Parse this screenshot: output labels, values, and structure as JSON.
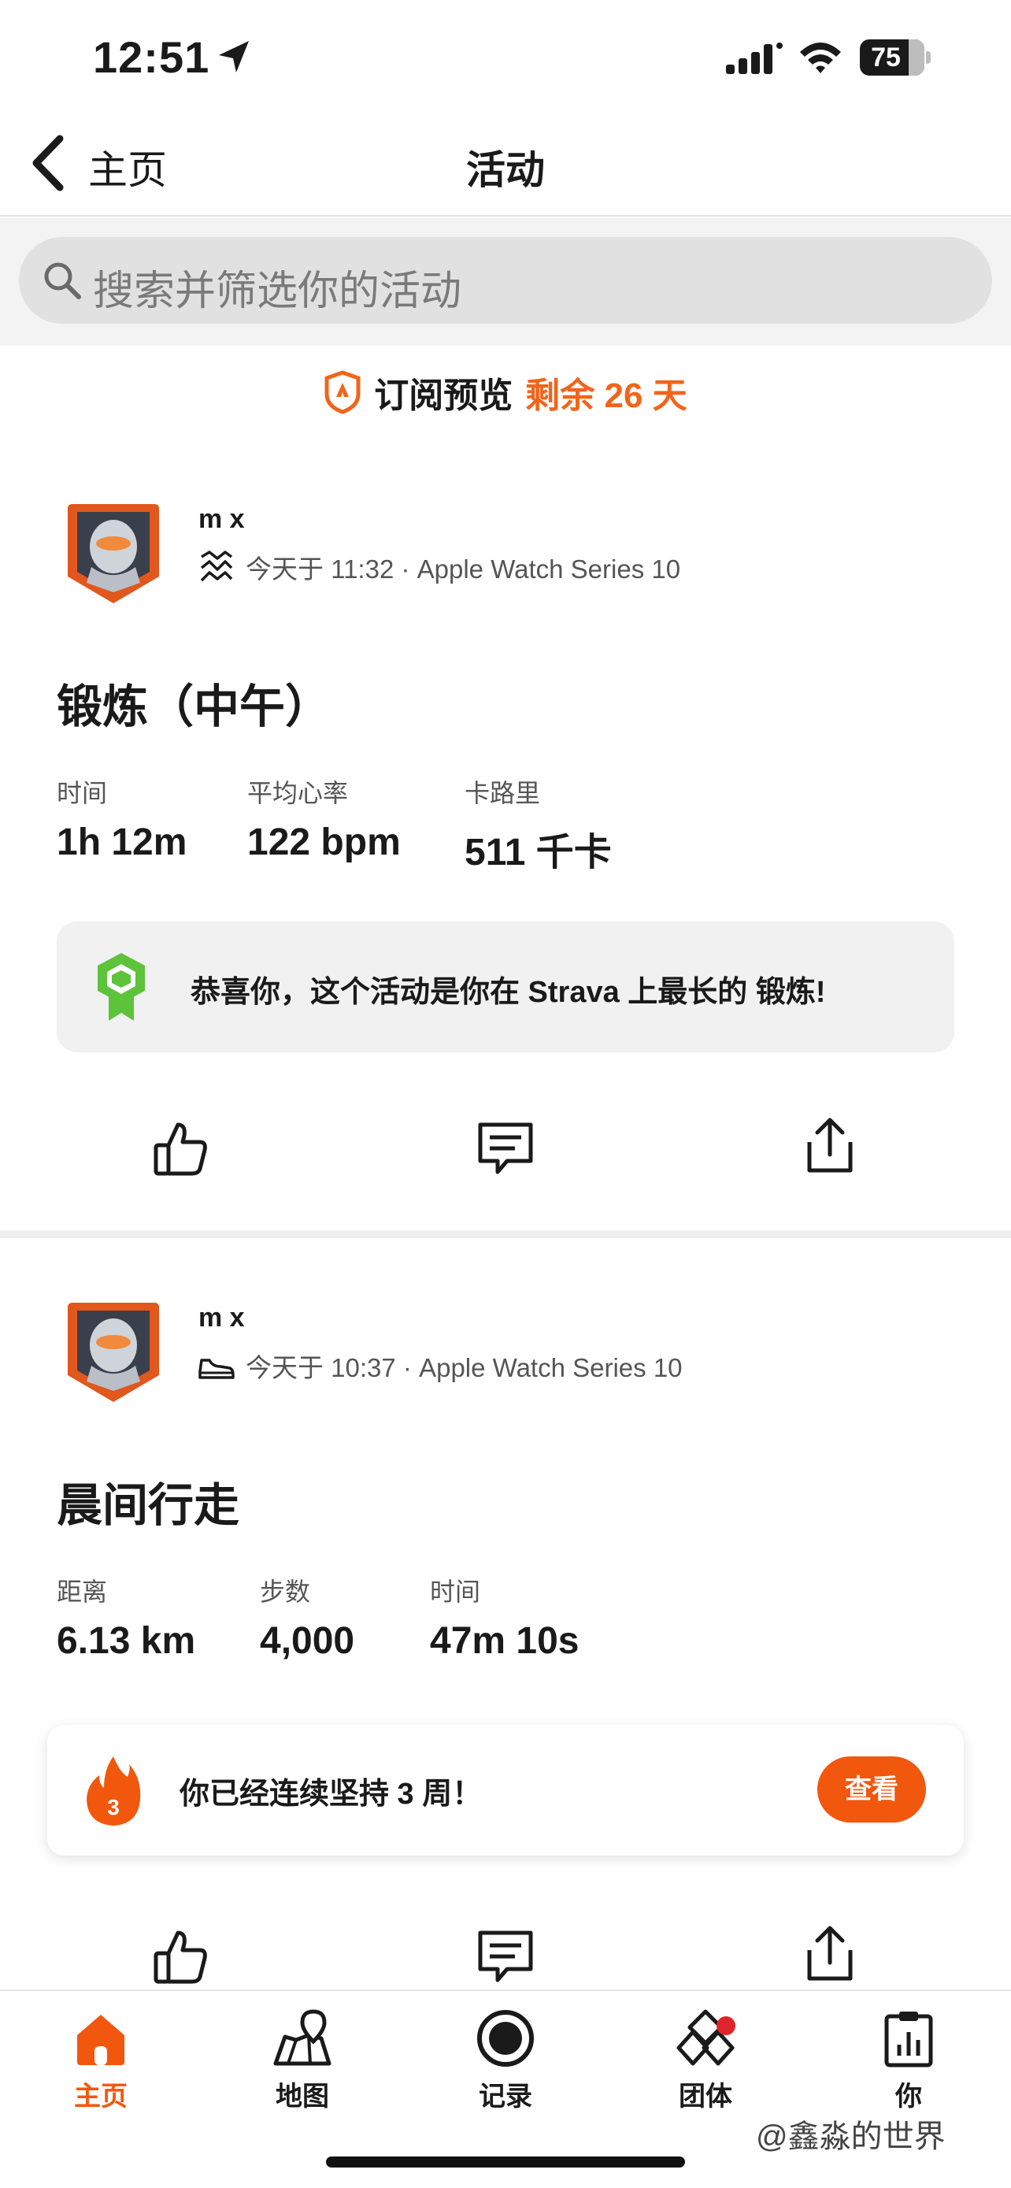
{
  "status_bar": {
    "time": "12:51",
    "battery": "75"
  },
  "nav": {
    "back_label": "主页",
    "title": "活动"
  },
  "search": {
    "placeholder": "搜索并筛选你的活动"
  },
  "subscription": {
    "label": "订阅预览",
    "remaining": "剩余 26 天"
  },
  "activities": [
    {
      "user": "m x",
      "meta": "今天于 11:32 · Apple Watch Series 10",
      "type_icon": "workout-wave-icon",
      "title": "锻炼（中午）",
      "stats": [
        {
          "label": "时间",
          "value": "1h 12m"
        },
        {
          "label": "平均心率",
          "value": "122 bpm"
        },
        {
          "label": "卡路里",
          "value": "511 千卡"
        }
      ],
      "achievement": "恭喜你，这个活动是你在 Strava 上最长的 锻炼!"
    },
    {
      "user": "m x",
      "meta": "今天于 10:37 · Apple Watch Series 10",
      "type_icon": "walking-shoe-icon",
      "title": "晨间行走",
      "stats": [
        {
          "label": "距离",
          "value": "6.13 km"
        },
        {
          "label": "步数",
          "value": "4,000"
        },
        {
          "label": "时间",
          "value": "47m 10s"
        }
      ],
      "streak": {
        "count": "3",
        "text": "你已经连续坚持 3 周！",
        "button": "查看"
      }
    }
  ],
  "tabs": [
    {
      "label": "主页",
      "icon": "home-icon",
      "active": true
    },
    {
      "label": "地图",
      "icon": "map-icon"
    },
    {
      "label": "记录",
      "icon": "record-icon"
    },
    {
      "label": "团体",
      "icon": "groups-icon",
      "badge": true
    },
    {
      "label": "你",
      "icon": "you-stats-icon"
    }
  ],
  "watermark": "@鑫淼的世界",
  "colors": {
    "accent": "#f2570e",
    "achievement_green": "#5cc33a",
    "badge_red": "#e0242b"
  }
}
